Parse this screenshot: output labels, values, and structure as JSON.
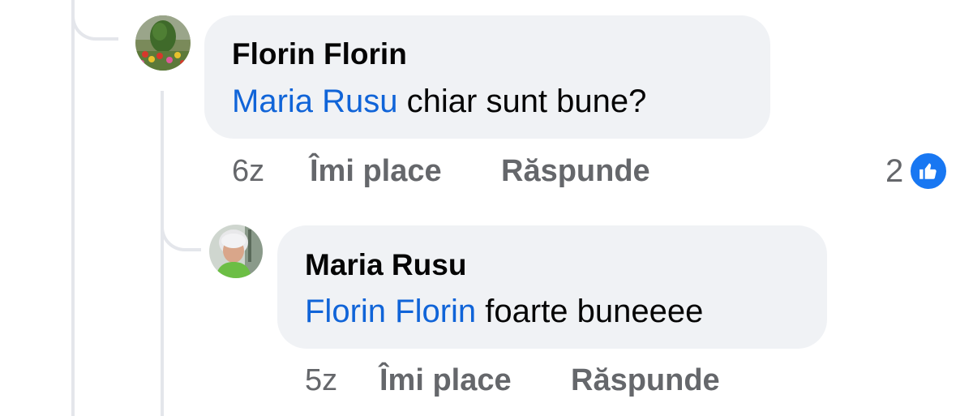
{
  "comments": [
    {
      "author": "Florin Florin",
      "mention": "Maria Rusu",
      "text": " chiar sunt bune?",
      "time": "6z",
      "like_label": "Îmi place",
      "reply_label": "Răspunde",
      "reaction_count": "2",
      "reaction_icon": "like-icon"
    },
    {
      "author": "Maria Rusu",
      "mention": "Florin Florin",
      "text": " foarte buneeee",
      "time": "5z",
      "like_label": "Îmi place",
      "reply_label": "Răspunde"
    }
  ],
  "colors": {
    "mention": "#1064d8",
    "bubble": "#f0f2f5",
    "meta": "#65676b",
    "like_badge": "#1877f2"
  }
}
